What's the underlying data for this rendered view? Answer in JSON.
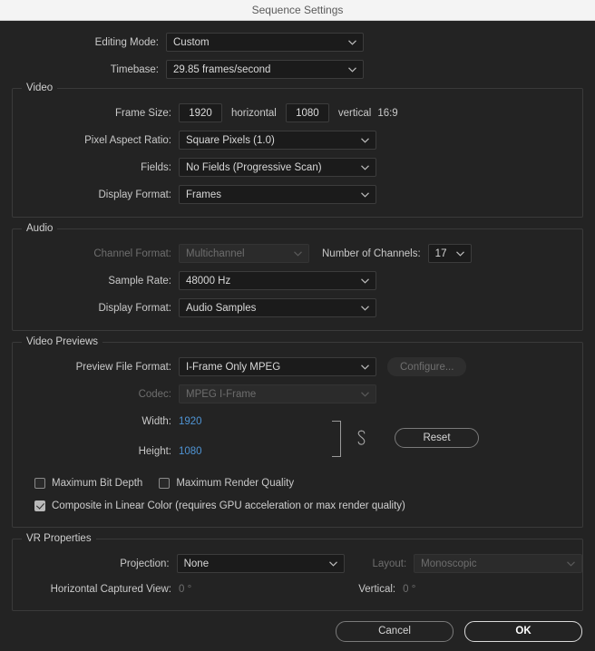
{
  "window": {
    "title": "Sequence Settings"
  },
  "top": {
    "editing_mode": {
      "label": "Editing Mode:",
      "value": "Custom"
    },
    "timebase": {
      "label": "Timebase:",
      "value": "29.85  frames/second"
    }
  },
  "video": {
    "legend": "Video",
    "frame_size": {
      "label": "Frame Size:",
      "horizontal_value": "1920",
      "horizontal_label": "horizontal",
      "vertical_value": "1080",
      "vertical_label": "vertical",
      "aspect_ratio": "16:9"
    },
    "pixel_aspect_ratio": {
      "label": "Pixel Aspect Ratio:",
      "value": "Square Pixels (1.0)"
    },
    "fields": {
      "label": "Fields:",
      "value": "No Fields (Progressive Scan)"
    },
    "display_format": {
      "label": "Display Format:",
      "value": "Frames"
    }
  },
  "audio": {
    "legend": "Audio",
    "channel_format": {
      "label": "Channel Format:",
      "value": "Multichannel"
    },
    "number_of_channels": {
      "label": "Number of Channels:",
      "value": "17"
    },
    "sample_rate": {
      "label": "Sample Rate:",
      "value": "48000 Hz"
    },
    "display_format": {
      "label": "Display Format:",
      "value": "Audio Samples"
    }
  },
  "video_previews": {
    "legend": "Video Previews",
    "preview_file_format": {
      "label": "Preview File Format:",
      "value": "I-Frame Only MPEG"
    },
    "configure_button": "Configure...",
    "codec": {
      "label": "Codec:",
      "value": "MPEG I-Frame"
    },
    "width": {
      "label": "Width:",
      "value": "1920"
    },
    "height": {
      "label": "Height:",
      "value": "1080"
    },
    "reset_button": "Reset",
    "checkboxes": {
      "maximum_bit_depth": {
        "label": "Maximum Bit Depth",
        "checked": false
      },
      "maximum_render_quality": {
        "label": "Maximum Render Quality",
        "checked": false
      },
      "composite_in_linear_color": {
        "label": "Composite in Linear Color (requires GPU acceleration or max render quality)",
        "checked": true
      }
    }
  },
  "vr_properties": {
    "legend": "VR Properties",
    "projection": {
      "label": "Projection:",
      "value": "None"
    },
    "layout": {
      "label": "Layout:",
      "value": "Monoscopic"
    },
    "horizontal_captured_view": {
      "label": "Horizontal Captured View:",
      "value": "0 °"
    },
    "vertical": {
      "label": "Vertical:",
      "value": "0 °"
    }
  },
  "footer": {
    "cancel": "Cancel",
    "ok": "OK"
  },
  "colors": {
    "dialog_bg": "#232323",
    "titlebar_bg": "#f4f4f4",
    "field_bg": "#1b1b1b",
    "link_blue": "#4f94d4",
    "checkbox_on": "#b9b9b9"
  }
}
